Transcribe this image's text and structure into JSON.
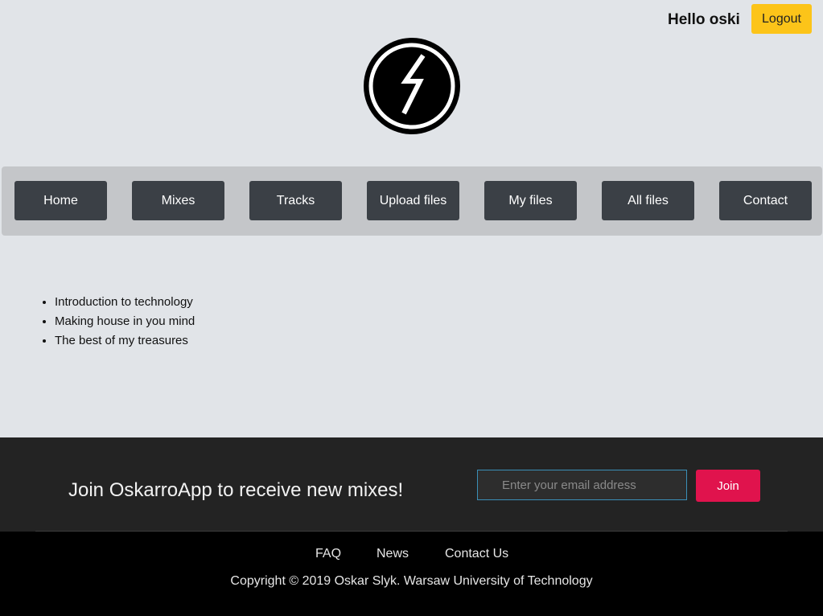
{
  "header": {
    "greeting": "Hello oski",
    "logout_label": "Logout",
    "logo_icon": "lightning-bolt-circle-icon"
  },
  "nav": {
    "items": [
      {
        "label": "Home"
      },
      {
        "label": "Mixes"
      },
      {
        "label": "Tracks"
      },
      {
        "label": "Upload files"
      },
      {
        "label": "My files"
      },
      {
        "label": "All files"
      },
      {
        "label": "Contact"
      }
    ]
  },
  "main": {
    "mixes": [
      "Introduction to technology",
      "Making house in you mind",
      "The best of my treasures"
    ]
  },
  "newsletter": {
    "title": "Join OskarroApp to receive new mixes!",
    "email_placeholder": "Enter your email address",
    "join_label": "Join"
  },
  "footer": {
    "links": [
      "FAQ",
      "News",
      "Contact Us"
    ],
    "copyright": "Copyright © 2019 Oskar Slyk. Warsaw University of Technology"
  },
  "colors": {
    "background": "#e1e4e8",
    "logout_button": "#fcc419",
    "nav_bar": "#c4c6c9",
    "nav_button": "#3b4046",
    "newsletter_bg": "#232323",
    "join_button": "#e0134d",
    "footer_bg": "#000000"
  }
}
